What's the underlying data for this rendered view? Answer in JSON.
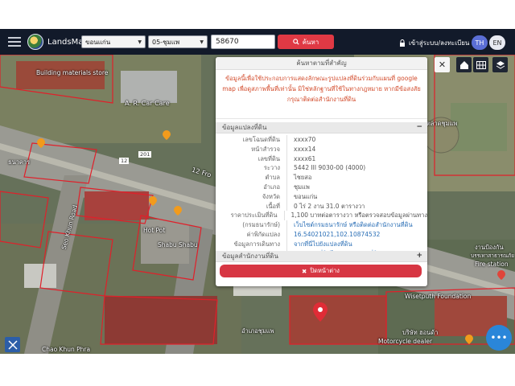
{
  "header": {
    "brand": "LandsMaps",
    "province_select": "ขอนแก่น",
    "district_select": "05-ชุมแพ",
    "parcel_input_value": "58670",
    "search_label": "ค้นหา",
    "login_label": "เข้าสู่ระบบ/ลงทะเบียน",
    "lang_th": "TH",
    "lang_en": "EN"
  },
  "panel": {
    "title": "ค้นหาตามที่สำคัญ",
    "note": "ข้อมูลนี้เพื่อใช้ประกอบการแสดงลักษณะรูปแปลงที่ดินร่วมกับแผนที่ google map เพื่อดูสภาพพื้นที่เท่านั้น มิใช่หลักฐานที่ใช้ในทางกฎหมาย หากมีข้อสงสัย กรุณาติดต่อสำนักงานที่ดิน",
    "section1": "ข้อมูลแปลงที่ดิน",
    "section1_toggle": "−",
    "rows": [
      {
        "k": "เลขโฉนดที่ดิน",
        "v": "xxxx70"
      },
      {
        "k": "หน้าสำรวจ",
        "v": "xxxx14"
      },
      {
        "k": "เลขที่ดิน",
        "v": "xxxx61"
      },
      {
        "k": "ระวาง",
        "v": "5442 III 9030-00 (4000)"
      },
      {
        "k": "ตำบล",
        "v": "ไชยสอ"
      },
      {
        "k": "อำเภอ",
        "v": "ชุมแพ"
      },
      {
        "k": "จังหวัด",
        "v": "ขอนแก่น"
      },
      {
        "k": "เนื้อที่",
        "v": "0 ไร่ 2 งาน 31.0 ตารางวา"
      },
      {
        "k": "ราคาประเมินที่ดิน",
        "v": "1,100 บาทต่อตารางวา หรือตรวจสอบข้อมูลผ่านทาง"
      },
      {
        "k": "(กรมธนารักษ์)",
        "v": "เว็บไซต์กรมธนารักษ์ หรือติดต่อสำนักงานที่ดิน"
      },
      {
        "k": "ค่าพิกัดแปลง",
        "v": "16.54021021,102.10874532"
      },
      {
        "k": "ข้อมูลการเดินทาง",
        "v": "จากที่นี่ไปยังแปลงที่ดิน"
      },
      {
        "k": "",
        "v": "จากแปลงที่ดินไปยังสำนักงานที่ดิน"
      }
    ],
    "section2": "ข้อมูลสำนักงานที่ดิน",
    "section2_toggle": "+",
    "close_label": "ปิดหน้าต่าง"
  },
  "map": {
    "labels": [
      "Building materials store",
      "A. R. Car Care",
      "201",
      "12",
      "12 Fro",
      "Seo Khun Road",
      "Hot Pot",
      "Shabu Shabu",
      "Chao Khun Phra",
      "Wisetputh Foundation",
      "Motorcycle dealer",
      "Fire station",
      "ตลาดชุมแพ",
      "ธนาคาร",
      "บริษัท ฮอนด้า",
      "งานป้องกัน",
      "บรรเทาสาธารณภัย",
      "อำเภอชุมแพ"
    ]
  },
  "colors": {
    "topbar": "#121a2a",
    "accent_red": "#e03944",
    "lang_active": "#5b6fd6",
    "fab": "#2a86d9"
  }
}
